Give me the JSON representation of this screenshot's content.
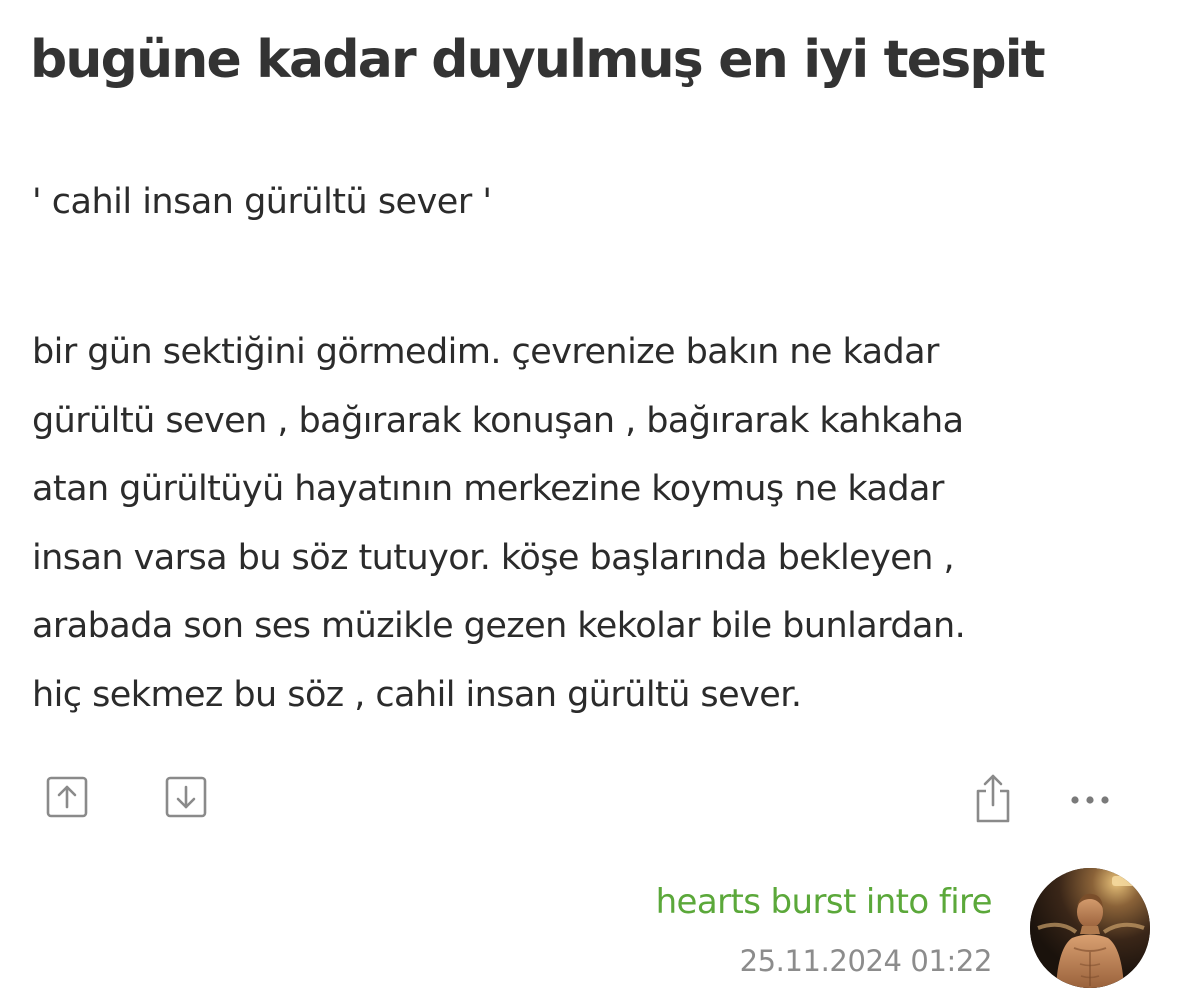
{
  "entry": {
    "title": "bugüne kadar duyulmuş en iyi tespit",
    "quote": "' cahil insan gürültü sever '",
    "body_lines": [
      "bir gün sektiğini görmedim. çevrenize bakın ne kadar",
      "gürültü seven , bağırarak konuşan , bağırarak kahkaha",
      "atan gürültüyü hayatının merkezine koymuş ne kadar",
      "insan varsa bu söz tutuyor. köşe başlarında bekleyen ,",
      "arabada son ses müzikle gezen kekolar bile bunlardan.",
      "hiç sekmez bu söz , cahil insan gürültü sever."
    ]
  },
  "actions": {
    "upvote_icon": "arrow-up-square-icon",
    "downvote_icon": "arrow-down-square-icon",
    "share_icon": "share-icon",
    "more_icon": "more-horizontal-icon"
  },
  "author": {
    "name": "hearts burst into fire",
    "timestamp": "25.11.2024 01:22",
    "avatar_icon": "user-avatar-photo"
  },
  "colors": {
    "text": "#2b2b2b",
    "title": "#333333",
    "author_link": "#5ba83a",
    "timestamp": "#8c8c8c",
    "icon": "#8a8a8a"
  }
}
